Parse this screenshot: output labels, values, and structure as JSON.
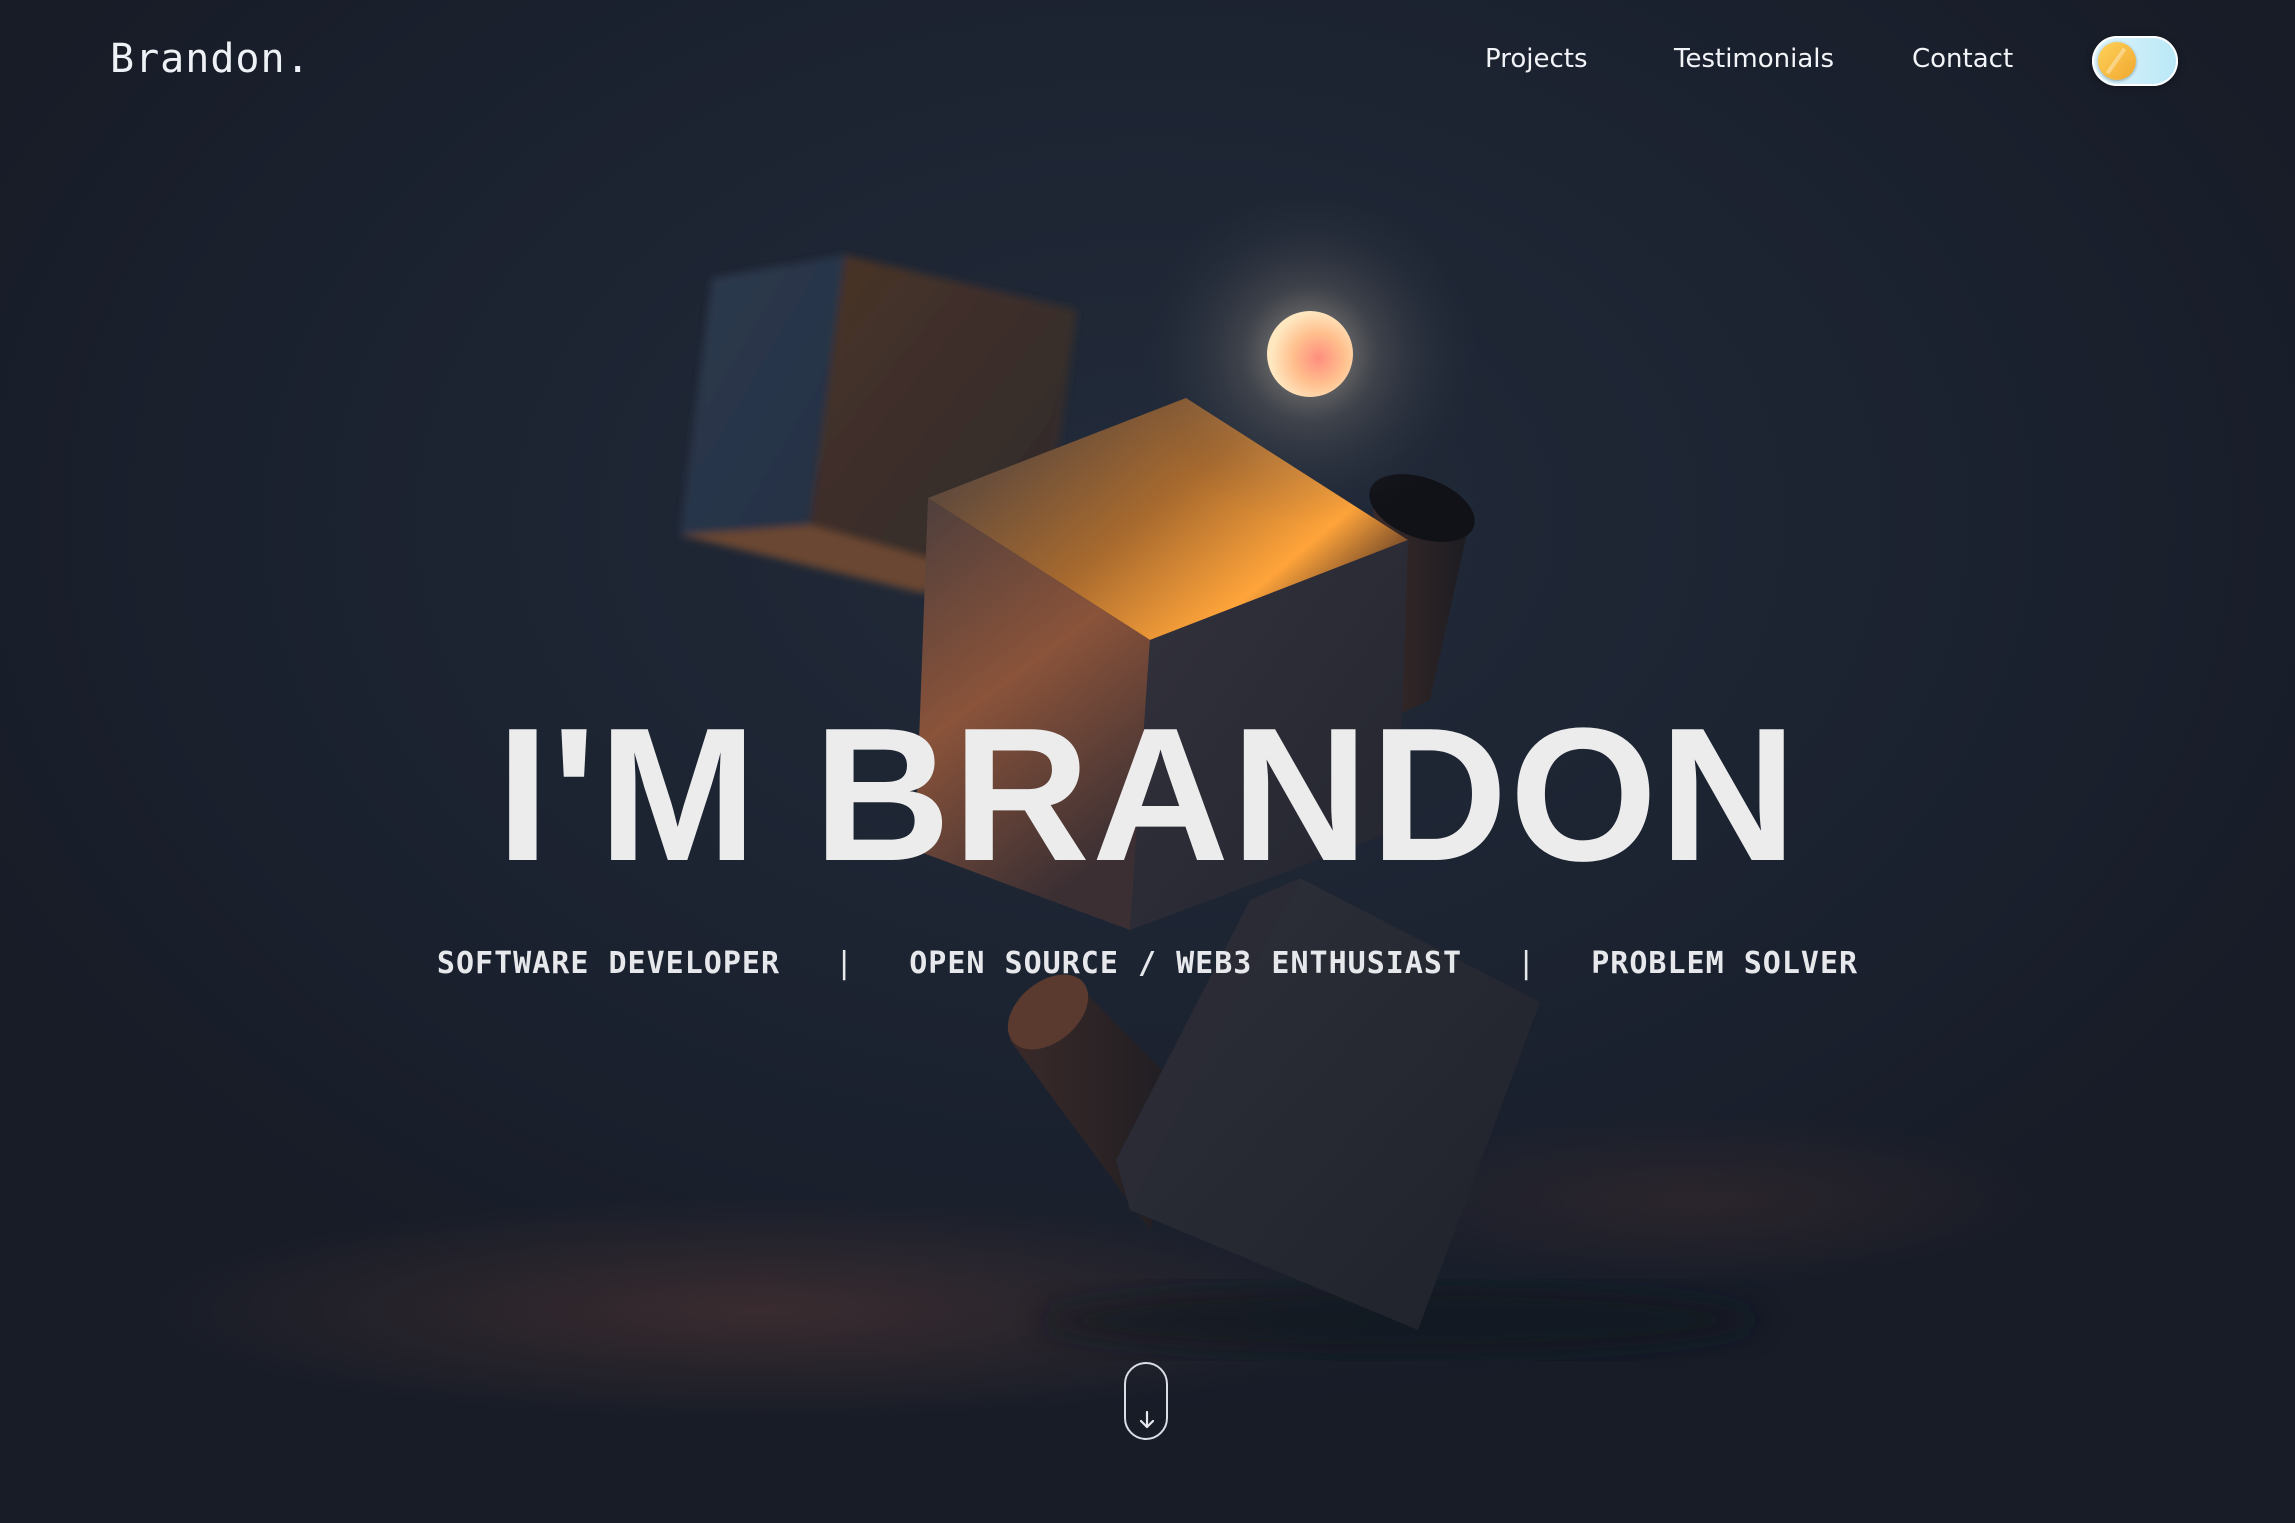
{
  "header": {
    "logo": "Brandon.",
    "nav": [
      {
        "label": "Projects"
      },
      {
        "label": "Testimonials"
      },
      {
        "label": "Contact"
      }
    ],
    "theme_toggle": {
      "icon": "sun-moon-toggle-icon"
    }
  },
  "hero": {
    "title": "I'M BRANDON",
    "roles": [
      "SOFTWARE DEVELOPER",
      "OPEN SOURCE / WEB3 ENTHUSIAST",
      "PROBLEM SOLVER"
    ],
    "separator": "|"
  },
  "scroll_indicator": {
    "icon": "arrow-down-icon"
  },
  "colors": {
    "background": "#1b2230",
    "text": "#ececec",
    "accent_orange": "#e8822b",
    "orb": "#ffb39a"
  }
}
